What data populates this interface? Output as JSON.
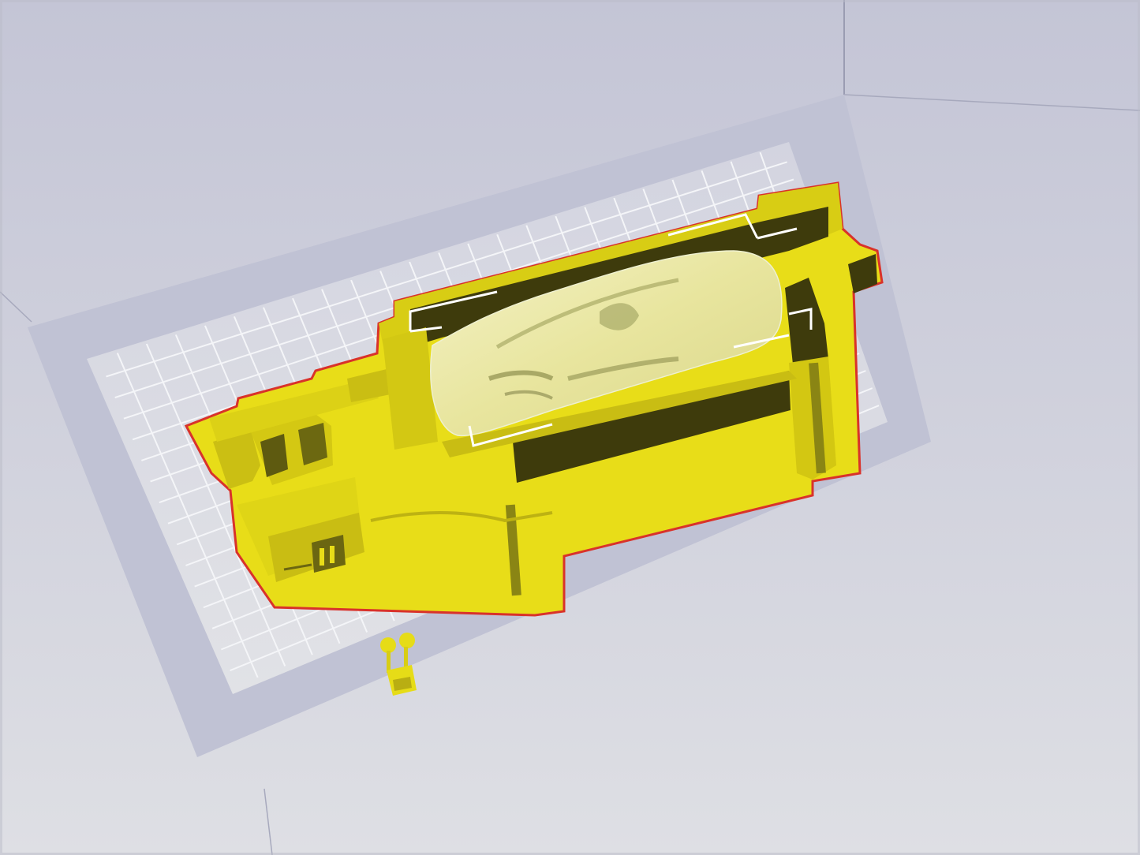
{
  "viewport": {
    "name": "slicer-3d-preview",
    "colors": {
      "background_top": "#c8c9d8",
      "background_bottom": "#dcdde3",
      "bed_surface": "#d9dae2",
      "bed_border": "#c4c6d6",
      "grid_line": "#f2f3f7",
      "model_yellow": "#e6dc17",
      "model_shadow": "#6e6a12",
      "model_dark": "#3d3a0c",
      "model_outline": "#d9322a",
      "selection_box": "#ffffff"
    }
  },
  "objects": [
    {
      "id": "car-base-diorama",
      "label": ""
    },
    {
      "id": "car-body",
      "label": ""
    },
    {
      "id": "small-part",
      "label": ""
    }
  ]
}
